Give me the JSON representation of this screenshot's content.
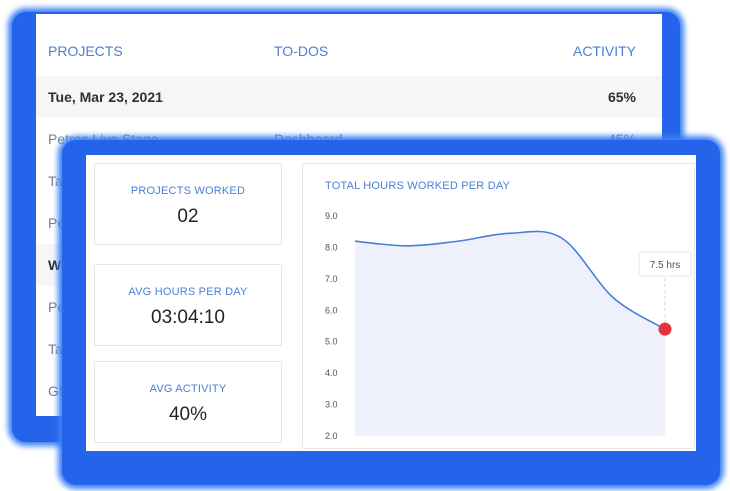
{
  "table": {
    "headers": {
      "projects": "PROJECTS",
      "todos": "TO-DOS",
      "activity": "ACTIVITY"
    },
    "rows": [
      {
        "type": "date",
        "project": "Tue, Mar 23, 2021",
        "todo": "",
        "activity": "65%"
      },
      {
        "type": "entry",
        "project": "Petros Live Stage...",
        "todo": "Dashboard",
        "activity": "45%"
      },
      {
        "type": "entry",
        "project": "Taxi bo",
        "todo": "",
        "activity": ""
      },
      {
        "type": "entry",
        "project": "Petros",
        "todo": "",
        "activity": ""
      },
      {
        "type": "date",
        "project": "Wed, M",
        "todo": "",
        "activity": ""
      },
      {
        "type": "entry",
        "project": "Petros",
        "todo": "",
        "activity": ""
      },
      {
        "type": "entry",
        "project": "Taxi bo",
        "todo": "",
        "activity": ""
      },
      {
        "type": "entry",
        "project": "GMC F",
        "todo": "",
        "activity": ""
      }
    ]
  },
  "stats": {
    "projects_worked": {
      "label": "PROJECTS WORKED",
      "value": "02"
    },
    "avg_hours": {
      "label": "AVG HOURS PER DAY",
      "value": "03:04:10"
    },
    "avg_activity": {
      "label": "AVG ACTIVITY",
      "value": "40%"
    }
  },
  "chart_data": {
    "type": "line",
    "title": "TOTAL HOURS WORKED PER DAY",
    "xlabel": "",
    "ylabel": "",
    "ylim": [
      2.0,
      9.0
    ],
    "yticks": [
      "9.0",
      "8.0",
      "7.0",
      "6.0",
      "5.0",
      "4.0",
      "3.0",
      "2.0"
    ],
    "grid": false,
    "x": [
      0,
      1,
      2,
      3,
      4,
      5,
      6
    ],
    "y": [
      8.2,
      8.05,
      8.2,
      8.45,
      8.3,
      6.4,
      5.4
    ],
    "area_fill": true,
    "highlight": {
      "index": 6,
      "label": "7.5 hrs"
    },
    "colors": {
      "line": "#4a7fd6",
      "area": "#eef0fb",
      "marker": "#e5323b"
    }
  }
}
